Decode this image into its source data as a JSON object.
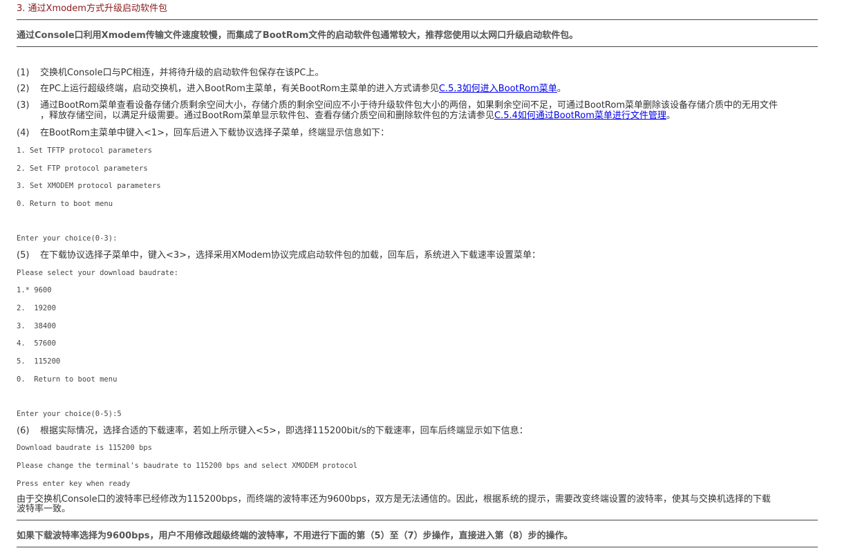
{
  "section_title": "3. 通过Xmodem方式升级启动软件包",
  "top_note": "通过Console口利用Xmodem传输文件速度较慢，而集成了BootRom文件的启动软件包通常较大，推荐您使用以太网口升级启动软件包。",
  "steps": [
    {
      "num": "(1)",
      "text": "交换机Console口与PC相连，并将待升级的启动软件包保存在该PC上。"
    },
    {
      "num": "(2)",
      "pre": "在PC上运行超级终端，启动交换机，进入BootRom主菜单，有关BootRom主菜单的进入方式请参见",
      "link": "C.5.3如何进入BootRom菜单",
      "post": "。"
    },
    {
      "num": "(3)",
      "line1": "通过BootRom菜单查看设备存储介质剩余空间大小，存储介质的剩余空间应不小于待升级软件包大小的两倍，如果剩余空间不足，可通过BootRom菜单删除该设备存储介质中的无用文件",
      "line2_pre": "，释放存储空间，以满足升级需要。通过BootRom菜单显示软件包、查看存储介质空间和删除软件包的方法请参见",
      "link": "C.5.4如何通过BootRom菜单进行文件管理",
      "post": "。"
    },
    {
      "num": "(4)",
      "text": "在BootRom主菜单中键入<1>，回车后进入下载协议选择子菜单，终端显示信息如下："
    },
    {
      "num": "(5)",
      "text": "在下载协议选择子菜单中，键入<3>，选择采用XModem协议完成启动软件包的加载，回车后，系统进入下载速率设置菜单："
    },
    {
      "num": "(6)",
      "text": "根据实际情况，选择合适的下载速率，若如上所示键入<5>，即选择115200bit/s的下载速率，回车后终端显示如下信息："
    }
  ],
  "code1": [
    "1. Set TFTP protocol parameters",
    "2. Set FTP protocol parameters",
    "3. Set XMODEM protocol parameters",
    "0. Return to boot menu",
    "Enter your choice(0-3):"
  ],
  "code2": [
    "Please select your download baudrate:",
    "1.* 9600",
    "2.  19200",
    "3.  38400",
    "4.  57600",
    "5.  115200",
    "0.  Return to boot menu",
    "Enter your choice(0-5):5"
  ],
  "code3": [
    "Download baudrate is 115200 bps",
    "Please change the terminal's baudrate to 115200 bps and select XMODEM protocol",
    "Press enter key when ready"
  ],
  "para": {
    "line1": "由于交换机Console口的波特率已经修改为115200bps，而终端的波特率还为9600bps，双方是无法通信的。因此，根据系统的提示，需要改变终端设置的波特率，使其与交换机选择的下载",
    "line2": "波特率一致。"
  },
  "bottom_note": "如果下载波特率选择为9600bps，用户不用修改超级终端的波特率，不用进行下面的第（5）至（7）步操作，直接进入第（8）步的操作。"
}
